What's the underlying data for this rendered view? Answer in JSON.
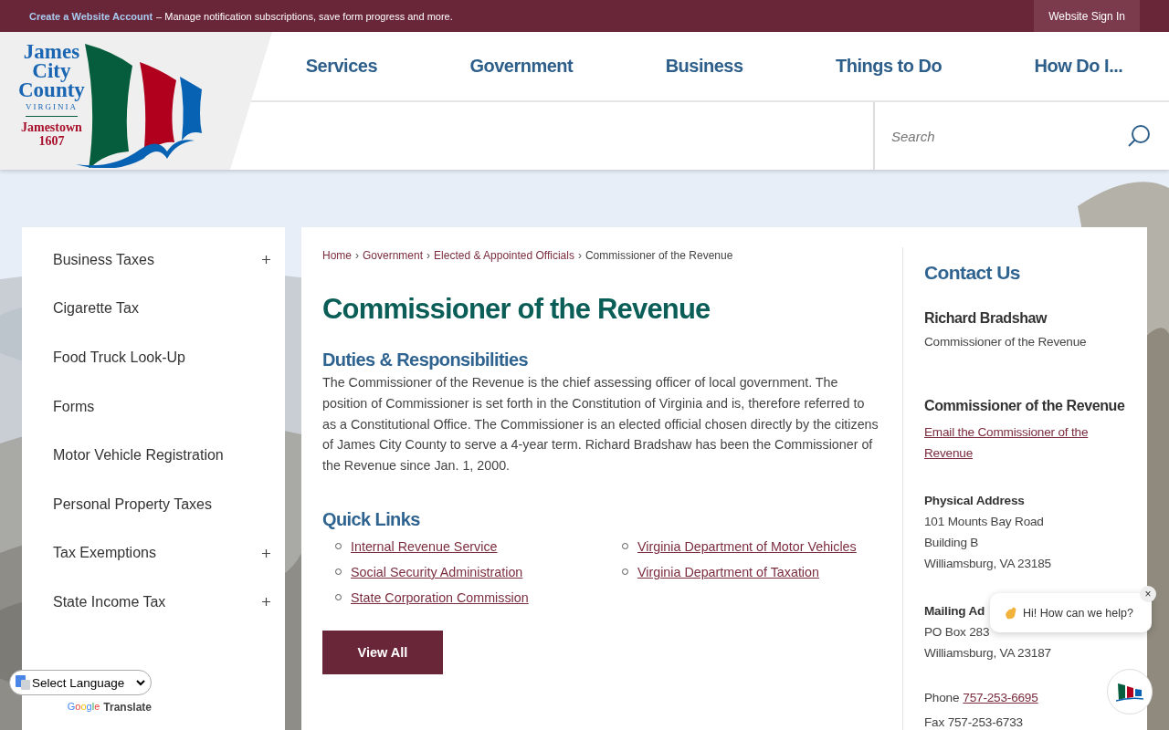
{
  "top_bar": {
    "account_link": "Create a Website Account",
    "account_text": "– Manage notification subscriptions, save form progress and more.",
    "sign_in": "Website Sign In"
  },
  "logo": {
    "lines": [
      "James",
      "City",
      "County"
    ],
    "state": "VIRGINIA",
    "town": "Jamestown",
    "year": "1607"
  },
  "nav": [
    {
      "label": "Services"
    },
    {
      "label": "Government"
    },
    {
      "label": "Business"
    },
    {
      "label": "Things to Do"
    },
    {
      "label": "How Do I..."
    }
  ],
  "search": {
    "placeholder": "Search"
  },
  "sidebar": {
    "items": [
      {
        "label": "Business Taxes",
        "expandable": true
      },
      {
        "label": "Cigarette Tax",
        "expandable": false
      },
      {
        "label": "Food Truck Look-Up",
        "expandable": false
      },
      {
        "label": "Forms",
        "expandable": false
      },
      {
        "label": "Motor Vehicle Registration",
        "expandable": false
      },
      {
        "label": "Personal Property Taxes",
        "expandable": false
      },
      {
        "label": "Tax Exemptions",
        "expandable": true
      },
      {
        "label": "State Income Tax",
        "expandable": true
      }
    ]
  },
  "breadcrumb": {
    "separator": "›",
    "items": [
      "Home",
      "Government",
      "Elected & Appointed Officials",
      "Commissioner of the Revenue"
    ]
  },
  "page_title": "Commissioner of the Revenue",
  "duties": {
    "heading": "Duties & Responsibilities",
    "text": "The Commissioner of the Revenue is the chief assessing officer of local government. The position of Commissioner is set forth in the Constitution of Virginia and is, therefore referred to as a Constitutional Office. The Commissioner is an elected official chosen directly by the citizens of James City County to serve a 4-year term. Richard Bradshaw has been the Commissioner of the Revenue since Jan. 1, 2000."
  },
  "quick_links": {
    "heading": "Quick Links",
    "links": [
      "Internal Revenue Service",
      "Social Security Administration",
      "State Corporation Commission",
      "Virginia Department of Motor Vehicles",
      "Virginia Department of Taxation"
    ],
    "view_all": "View All"
  },
  "contact": {
    "heading": "Contact Us",
    "name": "Richard Bradshaw",
    "title": "Commissioner of the Revenue",
    "office": "Commissioner of the Revenue",
    "email": "Email the Commissioner of the Revenue",
    "physical_label": "Physical Address",
    "physical_lines": [
      "101 Mounts Bay Road",
      "Building B",
      "Williamsburg, VA 23185"
    ],
    "mailing_label": "Mailing Ad",
    "mailing_lines": [
      "PO Box 283",
      "Williamsburg, VA 23187"
    ],
    "phone_label": "Phone",
    "phone": "757-253-6695",
    "fax": "Fax 757-253-6733"
  },
  "chat": {
    "message": "Hi! How can we help?",
    "close": "×"
  },
  "translate": {
    "select": "Select Language",
    "brand": "Google",
    "label": "Translate"
  }
}
